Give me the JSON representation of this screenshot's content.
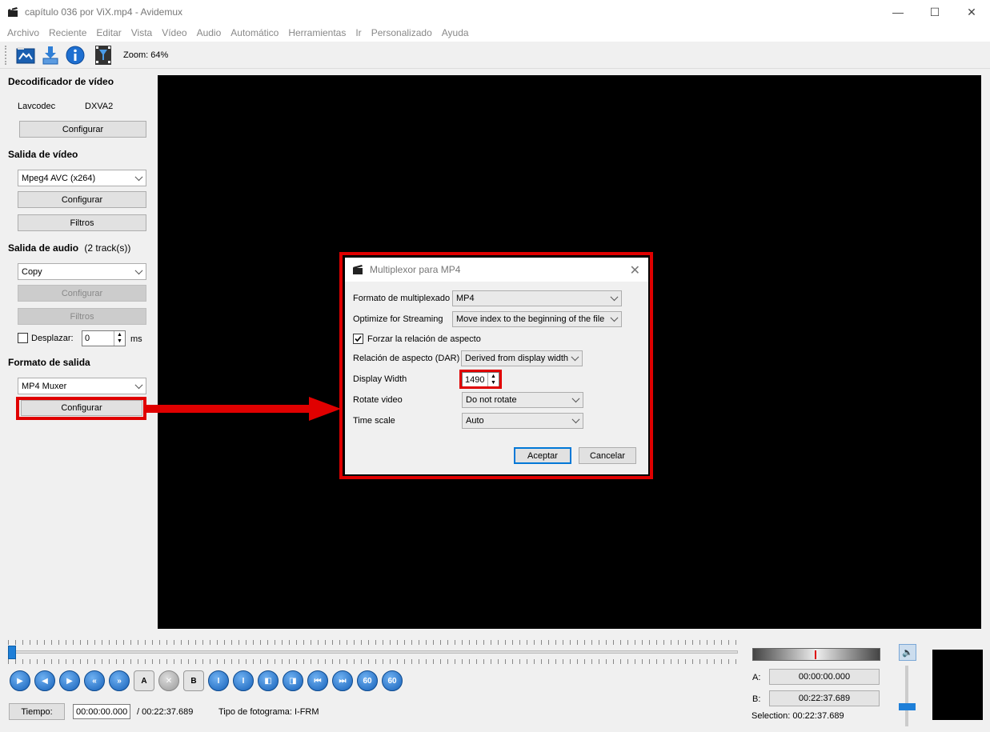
{
  "window": {
    "title": "capítulo 036 por ViX.mp4 - Avidemux",
    "minimize": "—",
    "maximize": "☐",
    "close": "✕"
  },
  "menu": [
    "Archivo",
    "Reciente",
    "Editar",
    "Vista",
    "Vídeo",
    "Audio",
    "Automático",
    "Herramientas",
    "Ir",
    "Personalizado",
    "Ayuda"
  ],
  "toolbar": {
    "zoom": "Zoom: 64%"
  },
  "left": {
    "decoder_title": "Decodificador de vídeo",
    "decoder_name": "Lavcodec",
    "decoder_hw": "DXVA2",
    "decoder_config": "Configurar",
    "video_out_title": "Salida de vídeo",
    "video_codec": "Mpeg4 AVC (x264)",
    "video_config": "Configurar",
    "video_filters": "Filtros",
    "audio_out_title": "Salida de audio",
    "audio_tracks": "(2 track(s))",
    "audio_codec": "Copy",
    "audio_config": "Configurar",
    "audio_filters": "Filtros",
    "shift_label": "Desplazar:",
    "shift_value": "0",
    "shift_unit": "ms",
    "format_title": "Formato de salida",
    "muxer": "MP4 Muxer",
    "muxer_config": "Configurar"
  },
  "dialog": {
    "title": "Multiplexor para MP4",
    "close": "✕",
    "mux_format_label": "Formato de multiplexado",
    "mux_format_value": "MP4",
    "streaming_label": "Optimize for Streaming",
    "streaming_value": "Move index to the beginning of the file",
    "force_aspect_label": "Forzar la relación de aspecto",
    "dar_label": "Relación de aspecto (DAR)",
    "dar_value": "Derived from display width",
    "display_width_label": "Display Width",
    "display_width_value": "1490",
    "rotate_label": "Rotate video",
    "rotate_value": "Do not rotate",
    "timescale_label": "Time scale",
    "timescale_value": "Auto",
    "ok": "Aceptar",
    "cancel": "Cancelar"
  },
  "bottom": {
    "time_button": "Tiempo:",
    "current_time": "00:00:00.000",
    "total_time": "/ 00:22:37.689",
    "frame_type": "Tipo de fotograma:  I-FRM",
    "a_label": "A:",
    "a_value": "00:00:00.000",
    "b_label": "B:",
    "b_value": "00:22:37.689",
    "selection": "Selection: 00:22:37.689",
    "btn_a": "A",
    "btn_b": "B",
    "btn_60a": "60",
    "btn_60b": "60"
  },
  "colors": {
    "highlight": "#e00000",
    "accent": "#1e7fd8"
  }
}
